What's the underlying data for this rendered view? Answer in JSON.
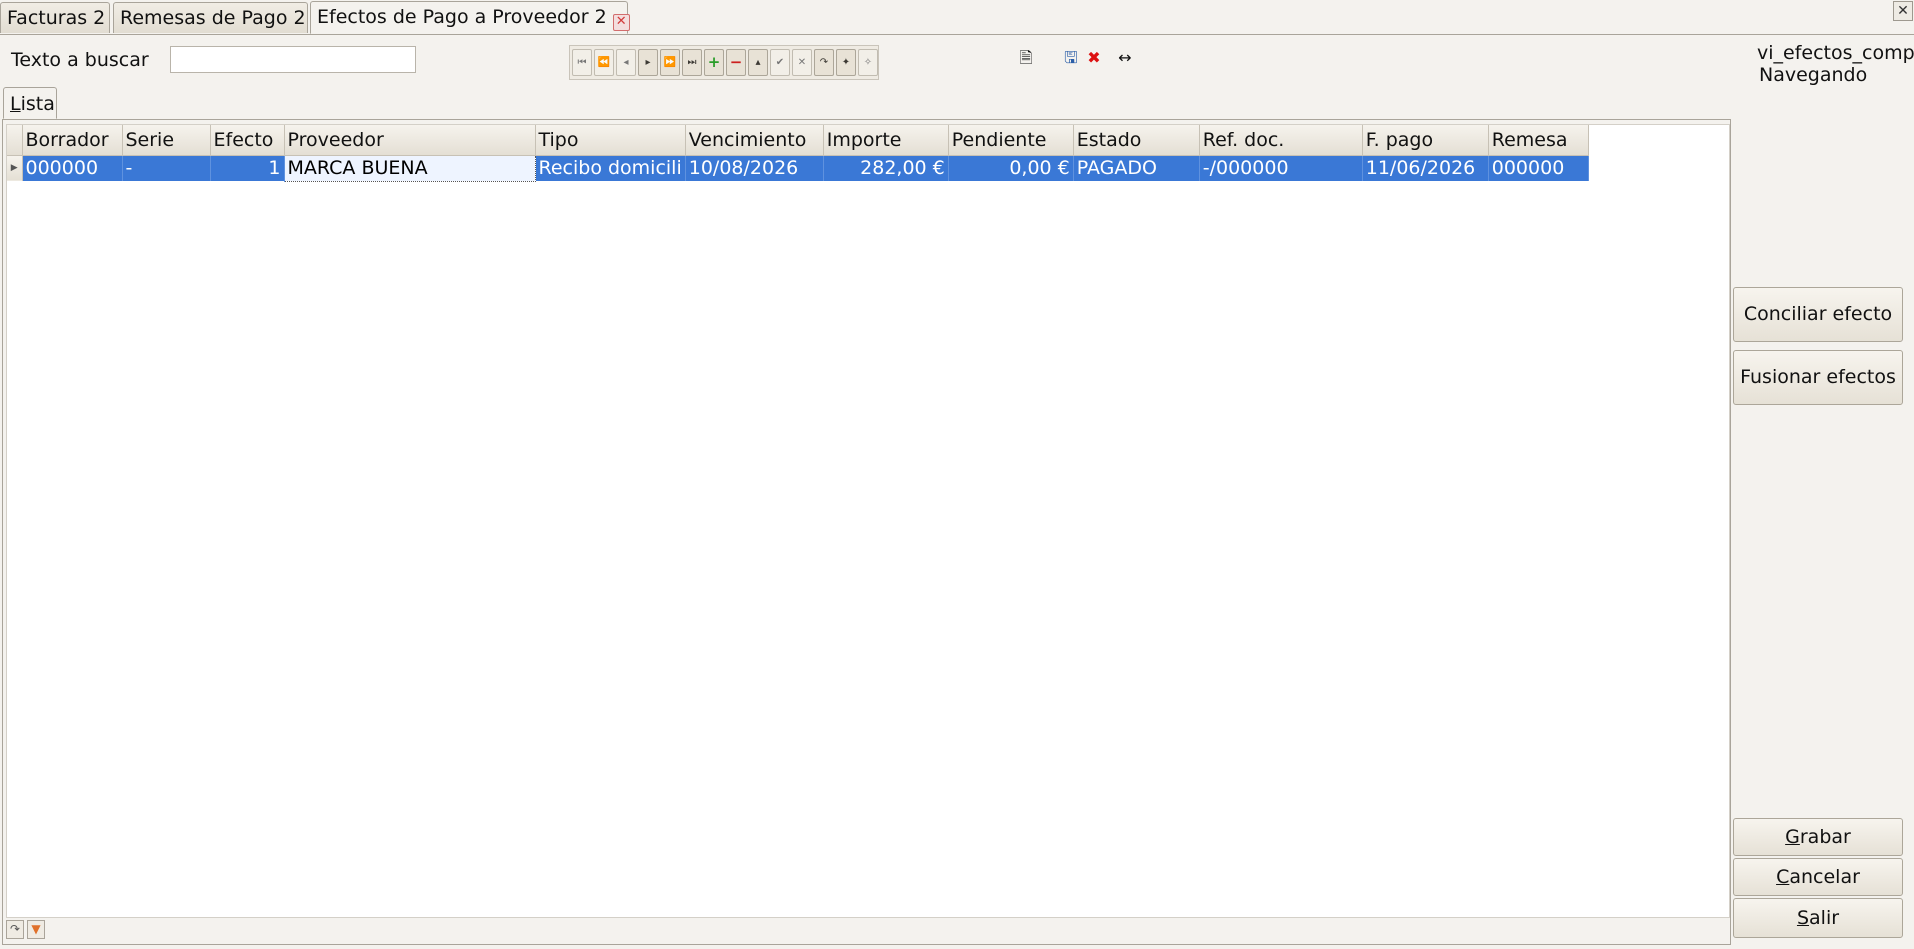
{
  "doc_tabs": [
    {
      "label": "Facturas 2"
    },
    {
      "label": "Remesas de Pago 2"
    },
    {
      "label": "Efectos de Pago a Proveedor 2"
    }
  ],
  "search": {
    "label": "Texto a buscar",
    "value": "",
    "placeholder": ""
  },
  "status": {
    "table": "vi_efectos_comp",
    "mode": "Navegando"
  },
  "inner_tab": {
    "mnemonic": "L",
    "rest": "ista"
  },
  "grid": {
    "columns": [
      "Borrador",
      "Serie",
      "Efecto",
      "Proveedor",
      "Tipo",
      "Vencimiento",
      "Importe",
      "Pendiente",
      "Estado",
      "Ref. doc.",
      "F. pago",
      "Remesa"
    ],
    "rows": [
      {
        "borrador": "000000",
        "serie": "-",
        "efecto": "1",
        "proveedor": "MARCA BUENA",
        "tipo": "Recibo domicili",
        "vencimiento": "10/08/2026",
        "importe": "282,00 €",
        "pendiente": "0,00 €",
        "estado": "PAGADO",
        "ref_doc": "-/000000",
        "f_pago": "11/06/2026",
        "remesa": "000000"
      }
    ]
  },
  "actions": {
    "conciliar": "Conciliar efecto",
    "fusionar": "Fusionar efectos"
  },
  "footer_buttons": {
    "grabar": {
      "mnemonic": "G",
      "rest": "rabar"
    },
    "cancelar": {
      "mnemonic": "C",
      "rest": "ancelar"
    },
    "salir": {
      "mnemonic": "S",
      "rest": "alir"
    }
  },
  "colors": {
    "selection": "#3a78d6",
    "background": "#f4f2ee"
  }
}
